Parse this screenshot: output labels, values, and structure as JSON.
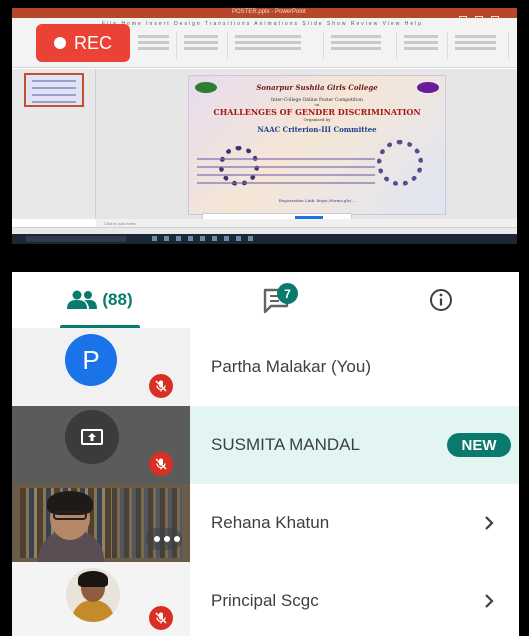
{
  "recording": {
    "label": "REC",
    "color": "#ea4335"
  },
  "shared_screen": {
    "app_title": "POSTER.pptx - PowerPoint",
    "ribbon_tabs": "File  Home  Insert  Design  Transitions  Animations  Slide Show  Review  View  Help",
    "slide": {
      "college": "Sonarpur Sushila Girls College",
      "event": "Inter-College Online Poster Competition",
      "on_label": "on",
      "topic": "CHALLENGES OF GENDER DISCRIMINATION",
      "organised_by": "Organised by",
      "committee": "NAAC Criterion-III Committee",
      "registration": "Registration Link: https://forms.gle/..."
    },
    "notes": "Click to add notes"
  },
  "tabs": {
    "people_count": "(88)",
    "chat_badge": "7",
    "accent": "#0b7a6e"
  },
  "participants": [
    {
      "name": "Partha Malakar (You)",
      "avatar_letter": "P",
      "muted": true
    },
    {
      "name": "SUSMITA MANDAL",
      "badge": "NEW",
      "presenting": true,
      "muted": true
    },
    {
      "name": "Rehana Khatun",
      "video": true
    },
    {
      "name": "Principal Scgc",
      "muted": true
    }
  ],
  "icons": {
    "people": "people-icon",
    "chat": "chat-icon",
    "info": "info-icon",
    "mic_off": "mic-off-icon",
    "present": "present-screen-icon",
    "chevron": "chevron-right-icon"
  }
}
